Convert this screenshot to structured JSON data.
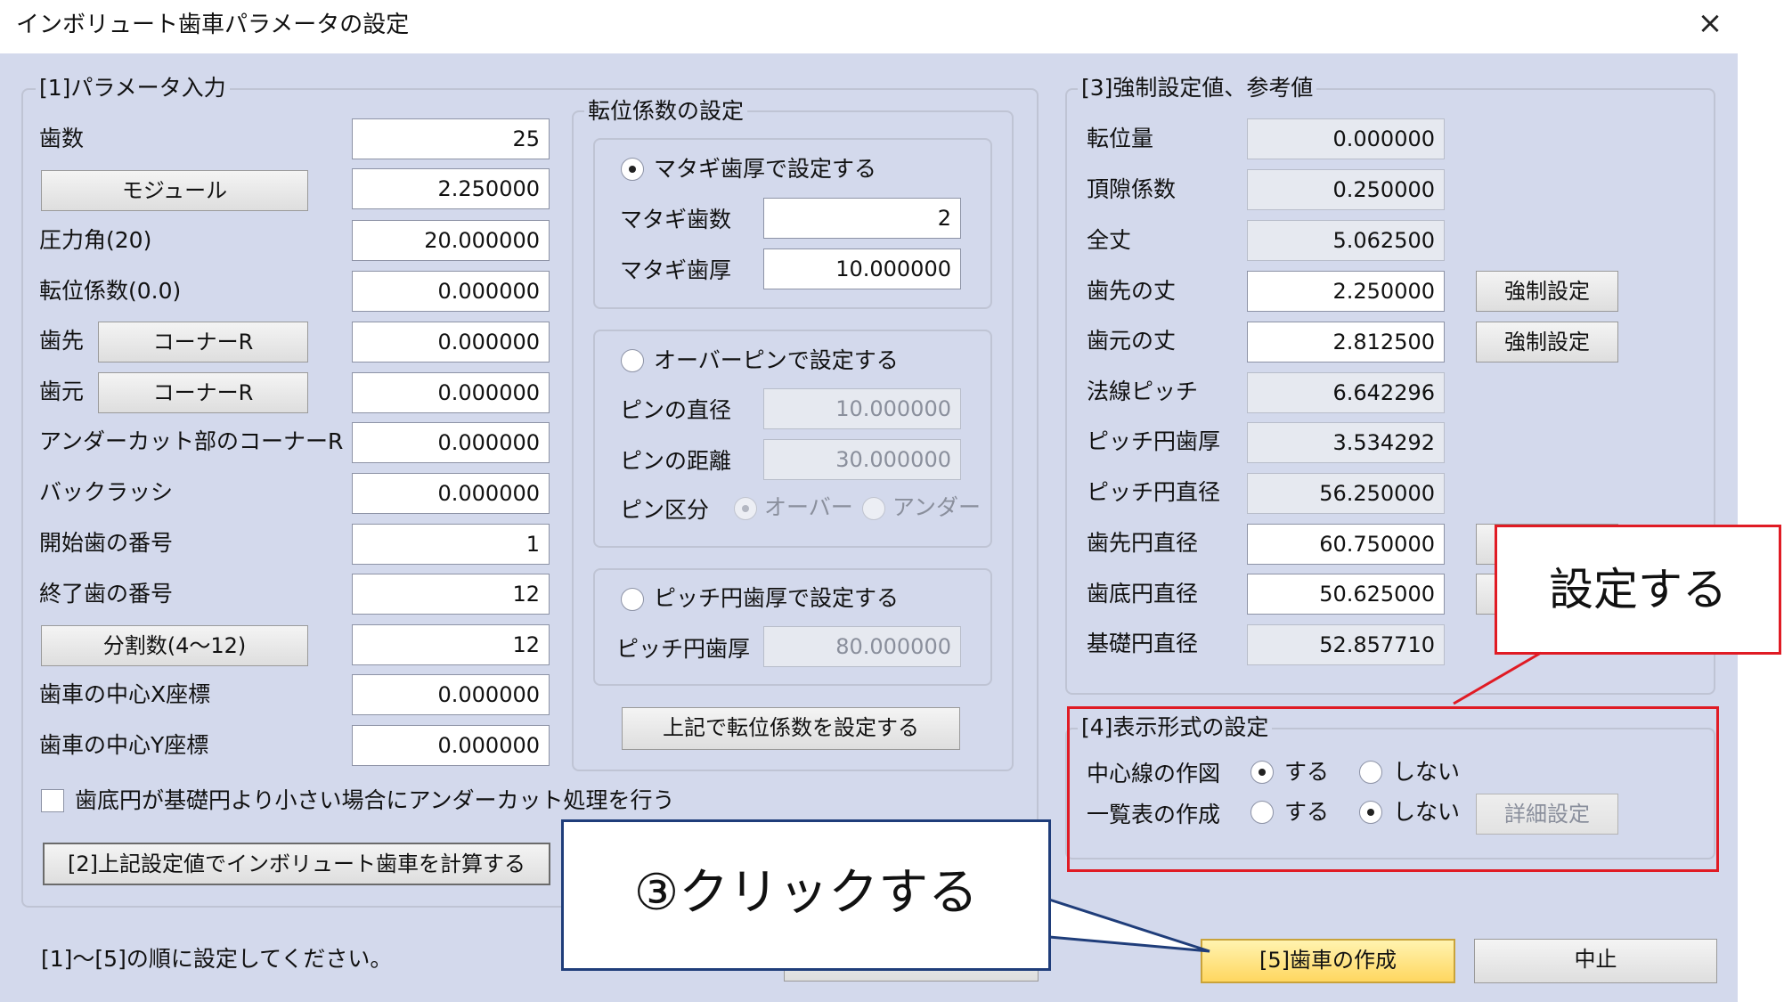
{
  "window": {
    "title": "インボリュート歯車パラメータの設定",
    "close_icon": "×"
  },
  "group1": {
    "label": "[1]パラメータ入力",
    "rows": {
      "teeth": {
        "label": "歯数",
        "value": "25"
      },
      "module": {
        "button": "モジュール",
        "value": "2.250000"
      },
      "pressure": {
        "label": "圧力角(20)",
        "value": "20.000000"
      },
      "shift": {
        "label": "転位係数(0.0)",
        "value": "0.000000"
      },
      "tip": {
        "label": "歯先",
        "button": "コーナーR",
        "value": "0.000000"
      },
      "root": {
        "label": "歯元",
        "button": "コーナーR",
        "value": "0.000000"
      },
      "undercut": {
        "label": "アンダーカット部のコーナーR",
        "value": "0.000000"
      },
      "backlash": {
        "label": "バックラッシ",
        "value": "0.000000"
      },
      "start": {
        "label": "開始歯の番号",
        "value": "1"
      },
      "end": {
        "label": "終了歯の番号",
        "value": "12"
      },
      "division": {
        "button": "分割数(4〜12)",
        "value": "12"
      },
      "cx": {
        "label": "歯車の中心X座標",
        "value": "0.000000"
      },
      "cy": {
        "label": "歯車の中心Y座標",
        "value": "0.000000"
      }
    },
    "undercut_check": "歯底円が基礎円より小さい場合にアンダーカット処理を行う",
    "calc_button": "[2]上記設定値でインボリュート歯車を計算する"
  },
  "shiftgroup": {
    "label": "転位係数の設定",
    "span": {
      "radio": "マタギ歯厚で設定する",
      "count_label": "マタギ歯数",
      "count_value": "2",
      "thick_label": "マタギ歯厚",
      "thick_value": "10.000000"
    },
    "pin": {
      "radio": "オーバーピンで設定する",
      "dia_label": "ピンの直径",
      "dia_value": "10.000000",
      "dist_label": "ピンの距離",
      "dist_value": "30.000000",
      "type_label": "ピン区分",
      "over": "オーバー",
      "under": "アンダー"
    },
    "pitch": {
      "radio": "ピッチ円歯厚で設定する",
      "thick_label": "ピッチ円歯厚",
      "thick_value": "80.000000"
    },
    "set_button": "上記で転位係数を設定する"
  },
  "group3": {
    "label": "[3]強制設定値、参考値",
    "rows": {
      "shift_amount": {
        "label": "転位量",
        "value": "0.000000"
      },
      "clearance": {
        "label": "頂隙係数",
        "value": "0.250000"
      },
      "whole": {
        "label": "全丈",
        "value": "5.062500"
      },
      "addendum": {
        "label": "歯先の丈",
        "value": "2.250000"
      },
      "dedendum": {
        "label": "歯元の丈",
        "value": "2.812500"
      },
      "normal_pitch": {
        "label": "法線ピッチ",
        "value": "6.642296"
      },
      "pitch_thick": {
        "label": "ピッチ円歯厚",
        "value": "3.534292"
      },
      "pitch_dia": {
        "label": "ピッチ円直径",
        "value": "56.250000"
      },
      "tip_dia": {
        "label": "歯先円直径",
        "value": "60.750000"
      },
      "root_dia": {
        "label": "歯底円直径",
        "value": "50.625000"
      },
      "base_dia": {
        "label": "基礎円直径",
        "value": "52.857710"
      }
    },
    "force_button": "強制設定"
  },
  "group4": {
    "label": "[4]表示形式の設定",
    "centerline_label": "中心線の作図",
    "table_label": "一覧表の作成",
    "yes": "する",
    "no": "しない",
    "detail_button": "詳細設定"
  },
  "footer": {
    "instruction": "[1]〜[5]の順に設定してください。",
    "create_button": "[5]歯車の作成",
    "cancel_button": "中止"
  },
  "annotations": {
    "set_callout": "設定する",
    "click_callout": "③クリックする",
    "highlight_color": "#e01b24",
    "callout_border": "#1f3d7a"
  }
}
